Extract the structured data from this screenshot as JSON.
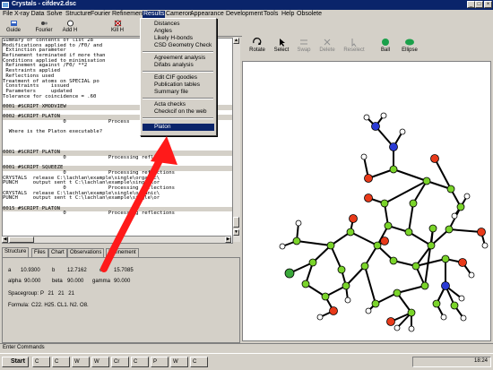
{
  "window": {
    "title": "Crystals - cifdev2.dsc"
  },
  "menubar": {
    "items": [
      "File",
      "X-ray Data",
      "Solve",
      "Structure",
      "Fourier",
      "Refinement",
      "Results",
      "Cameron",
      "Appearance",
      "Development",
      "Tools",
      "Help",
      "Obsolete"
    ],
    "open": "Results"
  },
  "toolbar": {
    "guide": "Guide",
    "fourier": "Fourier",
    "add_h": "Add H",
    "kill_h": "Kill H"
  },
  "results_menu": {
    "items": [
      "Distances",
      "Angles",
      "Likely H-bonds",
      "CSD Geometry Check",
      "Agreement analysis",
      "Difabs analysis",
      "Edit CIF goodies",
      "Publication tables",
      "Summary file",
      "Acta checks",
      "Checkcif on the web",
      "Platon"
    ],
    "highlighted": "Platon"
  },
  "text_pane": {
    "lines": [
      "Summary of contents of list 28",
      "Modifications applied to /F0/ and",
      " Extinction parameter",
      "Refinement terminated if more than",
      "Conditions applied to minimisation",
      " Refinement against /F0/ **2",
      " Restraints applied",
      " Reflections used",
      "Treatment of atoms on SPECIAL po",
      " Constraints    issued",
      " Parameters     updated",
      "Tolerance for coincidence = .60",
      "",
      "0001 #SCRIPT XMODVIEW",
      "",
      "0002 #SCRIPT PLATON",
      "                    0              Process",
      "",
      "  Where is the Platon executable?",
      "",
      "",
      "",
      "0001 #SCRIPT PLATON",
      "                    0              Processing reflections",
      "",
      "0001 #SCRIPT SQUEEZE",
      "                    0              Processing reflections",
      "CRYSTALS  release C:\\lachlan\\example\\single\\organic\\",
      "PUNCH     output sent t C:\\lachlan\\example\\single\\or",
      "                    0              Processing reflections",
      "CRYSTALS  release C:\\lachlan\\example\\single\\organic\\",
      "PUNCH     output sent t C:\\lachlan\\example\\single\\or",
      "",
      "0015 #SCRIPT PLATON",
      "                    0              Processing reflections",
      ""
    ]
  },
  "tabs": [
    "Structure",
    "Files",
    "Chart",
    "Observations",
    "Refinement"
  ],
  "cell": {
    "a_label": "a",
    "a": "10.9300",
    "b_label": "b",
    "b": "12.7162",
    "c_label": "c",
    "c": "15.7085",
    "alpha_label": "alpha",
    "alpha": "90.000",
    "beta_label": "beta",
    "beta": "90.000",
    "gamma_label": "gamma",
    "gamma": "90.000",
    "sg_label": "Spacegroup:",
    "spacegroup": "P 21 21 21",
    "formula_label": "Formula:",
    "formula": "C22. H25. CL1. N2. O8."
  },
  "graphics_toolbar": {
    "rotate": "Rotate",
    "select": "Select",
    "swap": "Swap",
    "delete": "Delete",
    "reselect": "Reselect",
    "ball": "Ball",
    "ellipse": "Ellipse"
  },
  "command_bar": {
    "label": "Enter Commands"
  },
  "taskbar": {
    "start": "Start",
    "tasks": [
      "C",
      "C",
      "W",
      "W",
      "Cr",
      "C",
      "P",
      "W",
      "C"
    ],
    "clock": "18:24"
  },
  "colors": {
    "carbon": "#7ad42a",
    "oxygen": "#e83a1a",
    "nitrogen": "#2a3ad4",
    "hydrogen": "#ffffff",
    "chlorine": "#3aa83a",
    "arrow": "#ff1a1a",
    "title_bar": "#0a246a"
  },
  "icons": [
    "guide-icon",
    "fourier-icon",
    "add-h-icon",
    "kill-h-icon",
    "rotate-icon",
    "select-icon",
    "ball-icon",
    "ellipse-icon"
  ]
}
